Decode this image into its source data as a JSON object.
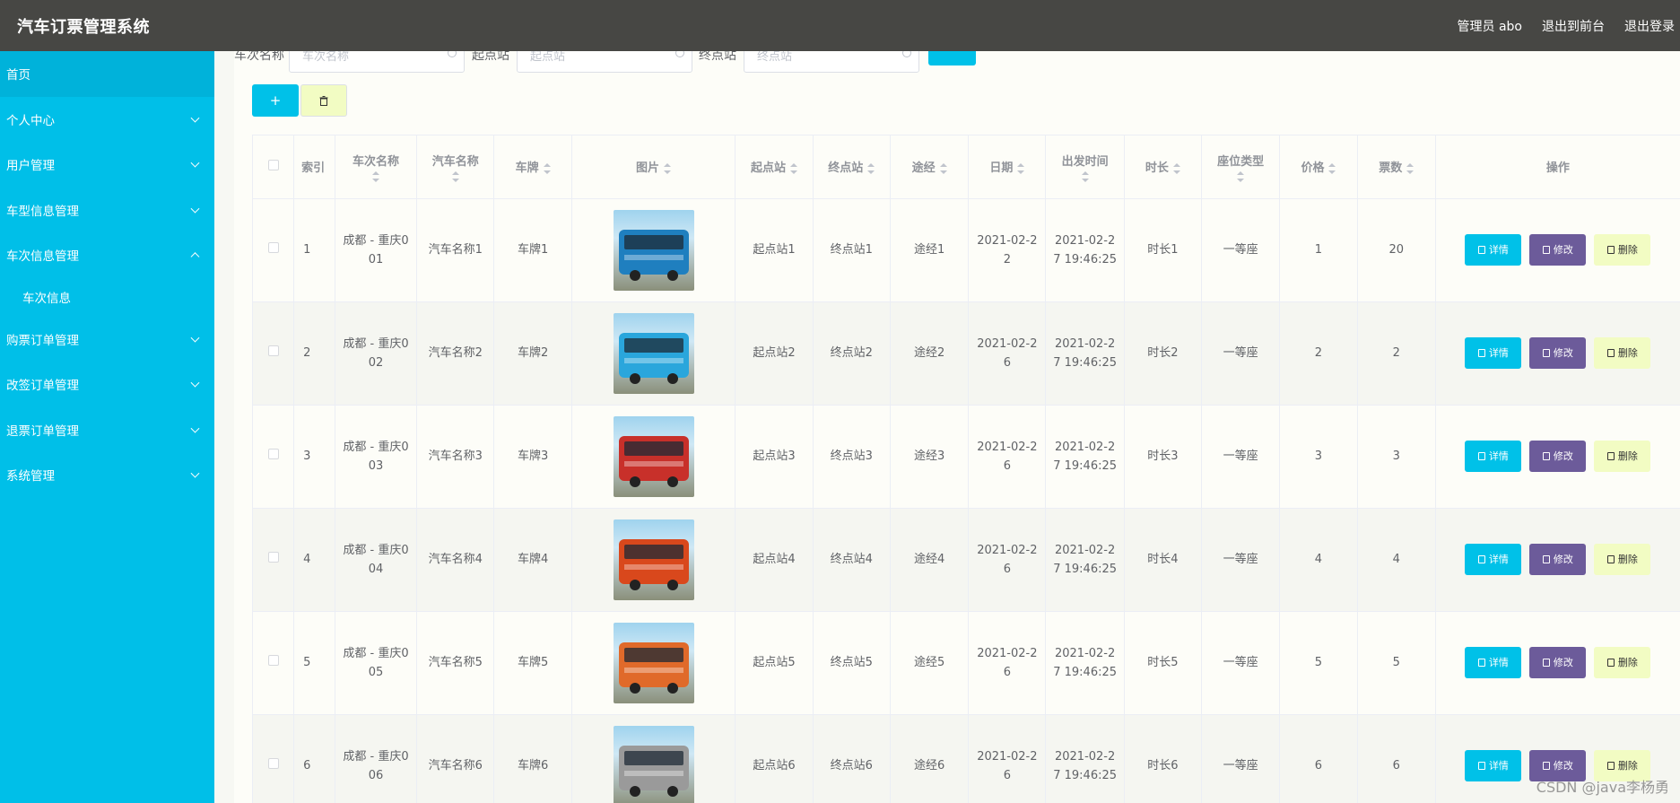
{
  "header": {
    "app_title": "汽车订票管理系统",
    "admin_label": "管理员 abo",
    "front_link": "退出到前台",
    "logout_link": "退出登录"
  },
  "sidebar": {
    "home": "首页",
    "items": [
      {
        "label": "个人中心"
      },
      {
        "label": "用户管理"
      },
      {
        "label": "车型信息管理"
      },
      {
        "label": "车次信息管理"
      },
      {
        "label": "车次信息"
      },
      {
        "label": "购票订单管理"
      },
      {
        "label": "改签订单管理"
      },
      {
        "label": "退票订单管理"
      },
      {
        "label": "系统管理"
      }
    ]
  },
  "search": {
    "label1": "车次名称",
    "placeholder1": "车次名称",
    "label2": "起点站",
    "placeholder2": "起点站",
    "label3": "终点站",
    "placeholder3": "终点站"
  },
  "toolbar": {
    "add_label": "+"
  },
  "table": {
    "headers": {
      "index": "索引",
      "trip_name": "车次名称",
      "bus_name": "汽车名称",
      "plate": "车牌",
      "image": "图片",
      "start": "起点站",
      "end": "终点站",
      "via": "途经",
      "date": "日期",
      "depart_time": "出发时间",
      "duration": "时长",
      "seat_type": "座位类型",
      "price": "价格",
      "tickets": "票数",
      "actions": "操作"
    },
    "rows": [
      {
        "index": "1",
        "trip_name": "成都 - 重庆001",
        "bus_name": "汽车名称1",
        "plate": "车牌1",
        "start": "起点站1",
        "end": "终点站1",
        "via": "途经1",
        "date": "2021-02-22",
        "depart_time": "2021-02-27 19:46:25",
        "duration": "时长1",
        "seat_type": "一等座",
        "price": "1",
        "tickets": "20"
      },
      {
        "index": "2",
        "trip_name": "成都 - 重庆002",
        "bus_name": "汽车名称2",
        "plate": "车牌2",
        "start": "起点站2",
        "end": "终点站2",
        "via": "途经2",
        "date": "2021-02-26",
        "depart_time": "2021-02-27 19:46:25",
        "duration": "时长2",
        "seat_type": "一等座",
        "price": "2",
        "tickets": "2"
      },
      {
        "index": "3",
        "trip_name": "成都 - 重庆003",
        "bus_name": "汽车名称3",
        "plate": "车牌3",
        "start": "起点站3",
        "end": "终点站3",
        "via": "途经3",
        "date": "2021-02-26",
        "depart_time": "2021-02-27 19:46:25",
        "duration": "时长3",
        "seat_type": "一等座",
        "price": "3",
        "tickets": "3"
      },
      {
        "index": "4",
        "trip_name": "成都 - 重庆004",
        "bus_name": "汽车名称4",
        "plate": "车牌4",
        "start": "起点站4",
        "end": "终点站4",
        "via": "途经4",
        "date": "2021-02-26",
        "depart_time": "2021-02-27 19:46:25",
        "duration": "时长4",
        "seat_type": "一等座",
        "price": "4",
        "tickets": "4"
      },
      {
        "index": "5",
        "trip_name": "成都 - 重庆005",
        "bus_name": "汽车名称5",
        "plate": "车牌5",
        "start": "起点站5",
        "end": "终点站5",
        "via": "途经5",
        "date": "2021-02-26",
        "depart_time": "2021-02-27 19:46:25",
        "duration": "时长5",
        "seat_type": "一等座",
        "price": "5",
        "tickets": "5"
      },
      {
        "index": "6",
        "trip_name": "成都 - 重庆006",
        "bus_name": "汽车名称6",
        "plate": "车牌6",
        "start": "起点站6",
        "end": "终点站6",
        "via": "途经6",
        "date": "2021-02-26",
        "depart_time": "2021-02-27 19:46:25",
        "duration": "时长6",
        "seat_type": "一等座",
        "price": "6",
        "tickets": "6"
      }
    ],
    "bus_colors": [
      "#1f7fbf",
      "#2aa6dc",
      "#c8302a",
      "#d9481c",
      "#e06a2a",
      "#9a9a9a"
    ],
    "action_labels": {
      "detail": "详情",
      "edit": "修改",
      "remove": "删除"
    }
  },
  "colors": {
    "header_bg": "#474744",
    "sidebar_bg": "#00bfe8",
    "primary": "#00c1e8",
    "edit": "#6c5b9a",
    "danger_soft": "#f2fcc3"
  },
  "watermark": "CSDN @java李杨勇"
}
